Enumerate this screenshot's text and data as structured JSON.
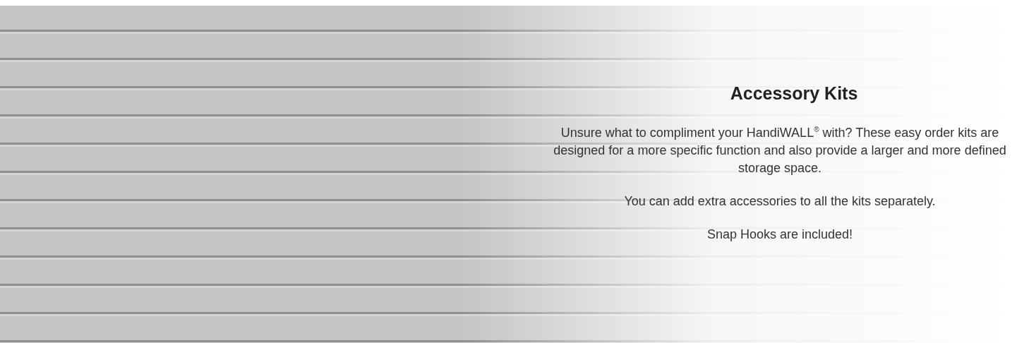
{
  "banner": {
    "heading": "Accessory Kits",
    "paragraphs": [
      "Unsure what to compliment your HandiWALL$^{®}$ with? These easy order kits are designed for a more specific function and also provide a larger and more defined storage space.",
      "You can add extra accessories to all the kits separately.",
      "Snap Hooks are included!"
    ]
  }
}
